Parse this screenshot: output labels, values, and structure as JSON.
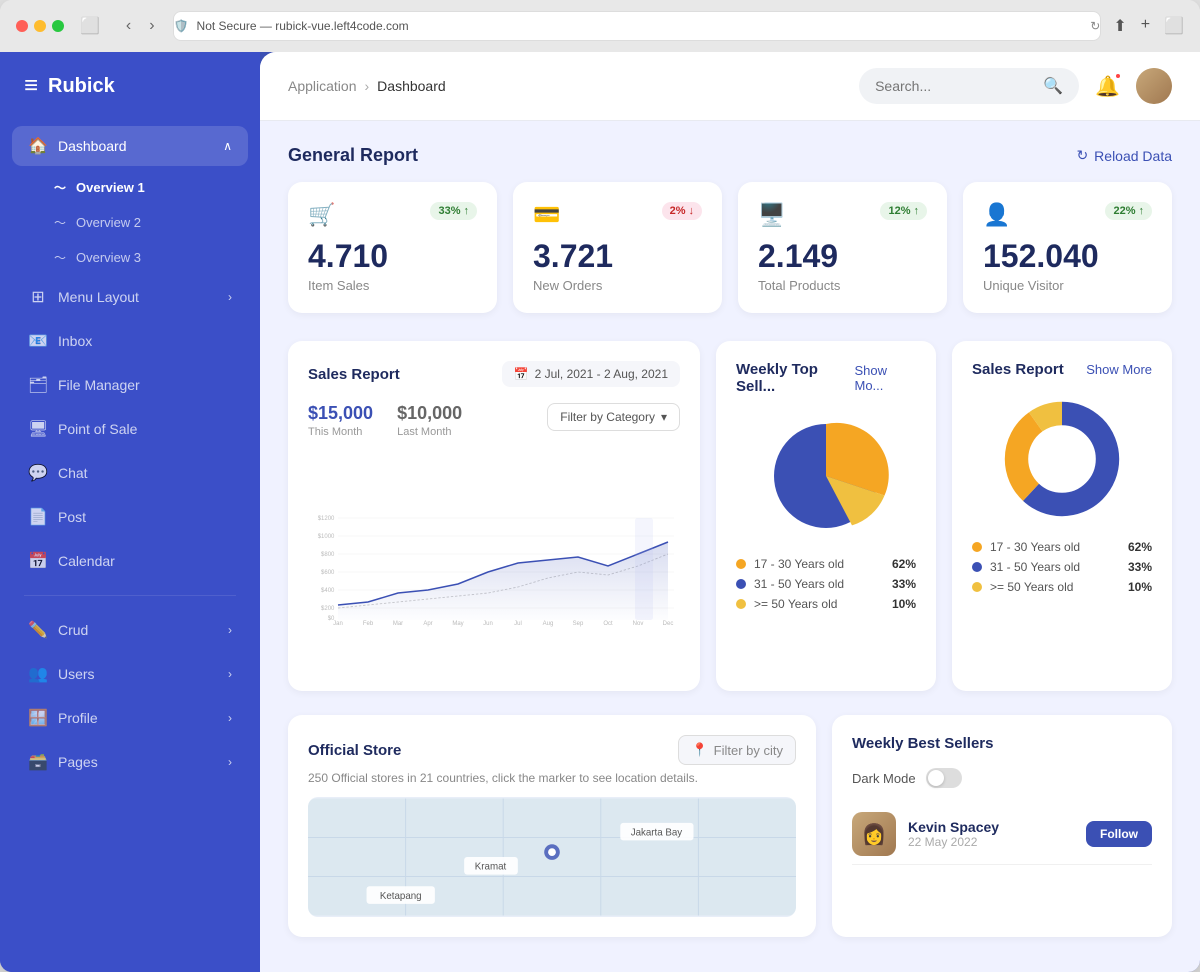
{
  "browser": {
    "address": "Not Secure — rubick-vue.left4code.com"
  },
  "sidebar": {
    "logo": "Rubick",
    "nav": [
      {
        "id": "dashboard",
        "label": "Dashboard",
        "icon": "🏠",
        "active": true,
        "hasArrow": true
      },
      {
        "id": "overview1",
        "label": "Overview 1",
        "icon": "📈",
        "sub": true,
        "active": true
      },
      {
        "id": "overview2",
        "label": "Overview 2",
        "icon": "📊",
        "sub": true
      },
      {
        "id": "overview3",
        "label": "Overview 3",
        "icon": "📉",
        "sub": true
      },
      {
        "id": "menu-layout",
        "label": "Menu Layout",
        "icon": "🔲",
        "hasArrow": true
      },
      {
        "id": "inbox",
        "label": "Inbox",
        "icon": "📧"
      },
      {
        "id": "file-manager",
        "label": "File Manager",
        "icon": "🗂️"
      },
      {
        "id": "point-of-sale",
        "label": "Point of Sale",
        "icon": "🖥️"
      },
      {
        "id": "chat",
        "label": "Chat",
        "icon": "💬"
      },
      {
        "id": "post",
        "label": "Post",
        "icon": "📄"
      },
      {
        "id": "calendar",
        "label": "Calendar",
        "icon": "📅"
      },
      {
        "id": "crud",
        "label": "Crud",
        "icon": "✏️",
        "hasArrow": true
      },
      {
        "id": "users",
        "label": "Users",
        "icon": "👥",
        "hasArrow": true
      },
      {
        "id": "profile",
        "label": "Profile",
        "icon": "🪟",
        "hasArrow": true
      },
      {
        "id": "pages",
        "label": "Pages",
        "icon": "🗃️",
        "hasArrow": true
      }
    ]
  },
  "topbar": {
    "breadcrumb_app": "Application",
    "breadcrumb_current": "Dashboard",
    "search_placeholder": "Search...",
    "reload_label": "Reload Data"
  },
  "general_report": {
    "title": "General Report",
    "stats": [
      {
        "icon": "🛒",
        "value": "4.710",
        "label": "Item Sales",
        "badge": "33%",
        "badge_type": "up"
      },
      {
        "icon": "💳",
        "value": "3.721",
        "label": "New Orders",
        "badge": "2%",
        "badge_type": "down"
      },
      {
        "icon": "🖥️",
        "value": "2.149",
        "label": "Total Products",
        "badge": "12%",
        "badge_type": "up"
      },
      {
        "icon": "👤",
        "value": "152.040",
        "label": "Unique Visitor",
        "badge": "22%",
        "badge_type": "up"
      }
    ]
  },
  "sales_report": {
    "title": "Sales Report",
    "date_range": "2 Jul, 2021 - 2 Aug, 2021",
    "this_month_value": "$15,000",
    "this_month_label": "This Month",
    "last_month_value": "$10,000",
    "last_month_label": "Last Month",
    "filter_label": "Filter by Category",
    "months": [
      "Jan",
      "Feb",
      "Mar",
      "Apr",
      "May",
      "Jun",
      "Jul",
      "Aug",
      "Sep",
      "Oct",
      "Nov",
      "Dec"
    ],
    "y_labels": [
      "$1200",
      "$1000",
      "$800",
      "$600",
      "$400",
      "$200",
      "$0"
    ]
  },
  "weekly_top_sellers": {
    "title": "Weekly Top Sell...",
    "show_more": "Show Mo...",
    "legend": [
      {
        "color": "#f5a623",
        "label": "17 - 30 Years old",
        "pct": "62%"
      },
      {
        "color": "#3b50b4",
        "label": "31 - 50 Years old",
        "pct": "33%"
      },
      {
        "color": "#f0c040",
        "label": ">= 50 Years old",
        "pct": "10%"
      }
    ]
  },
  "sales_report2": {
    "title": "Sales Report",
    "show_more": "Show More",
    "legend": [
      {
        "color": "#f5a623",
        "label": "17 - 30 Years old",
        "pct": "62%"
      },
      {
        "color": "#3b50b4",
        "label": "31 - 50 Years old",
        "pct": "33%"
      },
      {
        "color": "#f0c040",
        "label": ">= 50 Years old",
        "pct": "10%"
      }
    ]
  },
  "official_store": {
    "title": "Official Store",
    "subtitle": "250 Official stores in 21 countries, click the marker to see location details.",
    "filter_city_placeholder": "Filter by city",
    "map_labels": [
      "Ketapang",
      "Kramat",
      "Jakarta Bay"
    ]
  },
  "weekly_best_sellers": {
    "title": "Weekly Best Sellers",
    "dark_mode_label": "Dark Mode",
    "sellers": [
      {
        "name": "Kevin Spacey",
        "date": "22 May 2022",
        "btn": "Follow"
      }
    ]
  }
}
